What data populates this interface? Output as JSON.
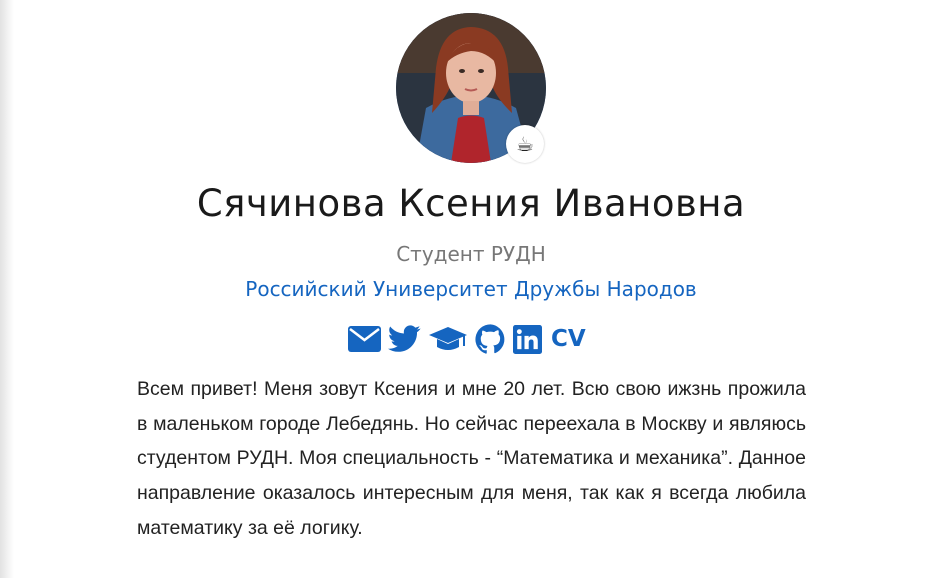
{
  "profile": {
    "name": "Сячинова Ксения Ивановна",
    "role": "Студент РУДН",
    "organization": "Российский Университет Дружбы Народов",
    "status_emoji": "☕",
    "avatar": "profile-photo"
  },
  "social": {
    "items": [
      {
        "icon": "envelope-icon",
        "label": "Email"
      },
      {
        "icon": "twitter-icon",
        "label": "Twitter"
      },
      {
        "icon": "graduation-cap-icon",
        "label": "Google Scholar"
      },
      {
        "icon": "github-icon",
        "label": "GitHub"
      },
      {
        "icon": "linkedin-icon",
        "label": "LinkedIn"
      }
    ],
    "cv_label": "CV"
  },
  "bio": {
    "text": "Всем привет! Меня зовут Ксения и мне 20 лет. Всю свою ижзнь прожила в маленьком городе Лебедянь. Но сейчас переехала в Москву и являюсь студентом РУДН. Моя специальность - “Математика и механика”. Данное направление оказалось интересным для меня, так как я всегда любила математику за её логику."
  },
  "colors": {
    "accent": "#1565c0",
    "muted_text": "#777777",
    "body_text": "#222222",
    "background": "#ffffff"
  }
}
